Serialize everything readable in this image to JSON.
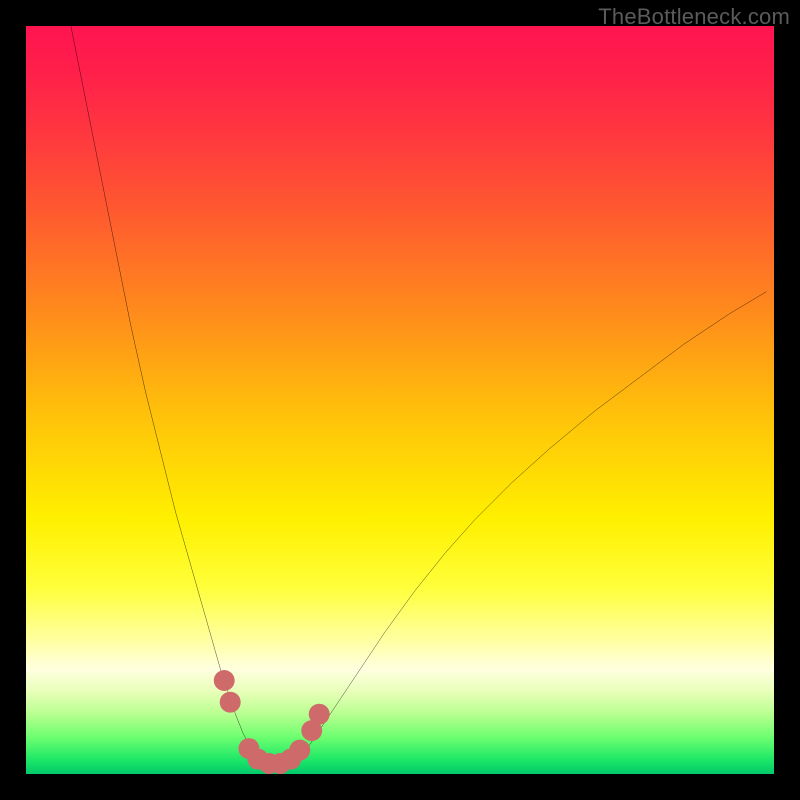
{
  "watermark": {
    "text": "TheBottleneck.com"
  },
  "chart_data": {
    "type": "line",
    "title": "",
    "xlabel": "",
    "ylabel": "",
    "xlim": [
      0,
      100
    ],
    "ylim": [
      0,
      100
    ],
    "grid": false,
    "series": [
      {
        "name": "bottleneck-curve",
        "color": "#000000",
        "x": [
          6,
          8,
          10,
          12,
          14,
          16,
          18,
          20,
          22,
          24,
          26,
          27,
          28,
          29,
          30,
          31,
          32,
          33,
          34,
          35,
          36,
          37,
          38,
          40,
          42,
          45,
          48,
          52,
          56,
          60,
          65,
          70,
          76,
          82,
          88,
          94,
          99
        ],
        "y": [
          100,
          90,
          80,
          70,
          60,
          51,
          43,
          35,
          28,
          21,
          14,
          11,
          8,
          5.5,
          3.5,
          2.2,
          1.4,
          1.0,
          1.0,
          1.2,
          1.8,
          2.8,
          4.0,
          7.0,
          10.0,
          14.5,
          19.0,
          24.5,
          29.5,
          34.0,
          39.0,
          43.5,
          48.5,
          53.0,
          57.5,
          61.5,
          64.5
        ]
      }
    ],
    "markers": {
      "name": "highlight-dots",
      "color": "#cf6a6a",
      "points": [
        {
          "x": 26.5,
          "y": 12.5
        },
        {
          "x": 27.3,
          "y": 9.6
        },
        {
          "x": 29.8,
          "y": 3.4
        },
        {
          "x": 31.0,
          "y": 2.0
        },
        {
          "x": 32.5,
          "y": 1.4
        },
        {
          "x": 34.0,
          "y": 1.4
        },
        {
          "x": 35.4,
          "y": 2.0
        },
        {
          "x": 36.6,
          "y": 3.2
        },
        {
          "x": 38.2,
          "y": 5.8
        },
        {
          "x": 39.2,
          "y": 8.0
        }
      ]
    },
    "gradient_stops": [
      {
        "offset": 0.0,
        "color": "#ff1450"
      },
      {
        "offset": 0.25,
        "color": "#ff5a2f"
      },
      {
        "offset": 0.52,
        "color": "#ffc20a"
      },
      {
        "offset": 0.75,
        "color": "#ffff3a"
      },
      {
        "offset": 0.92,
        "color": "#b8ff90"
      },
      {
        "offset": 1.0,
        "color": "#00c96a"
      }
    ]
  }
}
